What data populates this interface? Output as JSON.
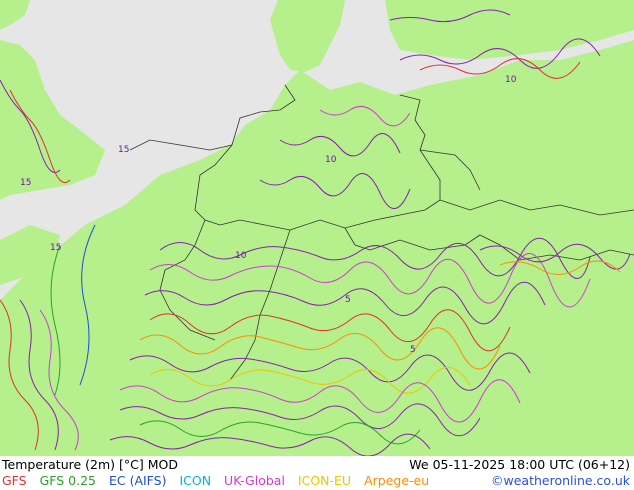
{
  "title": "Temperature (2m) [°C] MOD",
  "datetime": "We 05-11-2025 18:00 UTC (06+12)",
  "credit": "©weatheronline.co.uk",
  "legend": [
    {
      "label": "GFS",
      "color": "#e03030"
    },
    {
      "label": "GFS 0.25",
      "color": "#2ca02c"
    },
    {
      "label": "EC (AIFS)",
      "color": "#1f4fd0"
    },
    {
      "label": "ICON",
      "color": "#00b8d0"
    },
    {
      "label": "UK-Global",
      "color": "#d23ad2"
    },
    {
      "label": "ICON-EU",
      "color": "#e8c800"
    },
    {
      "label": "Arpege-eu",
      "color": "#ff8c00"
    }
  ],
  "contour_labels": [
    "5",
    "10",
    "15"
  ],
  "colors": {
    "land": "#b5f08c",
    "sea": "#e6e6e6",
    "border": "#333333",
    "dense_contour": "#8a1fb0"
  }
}
